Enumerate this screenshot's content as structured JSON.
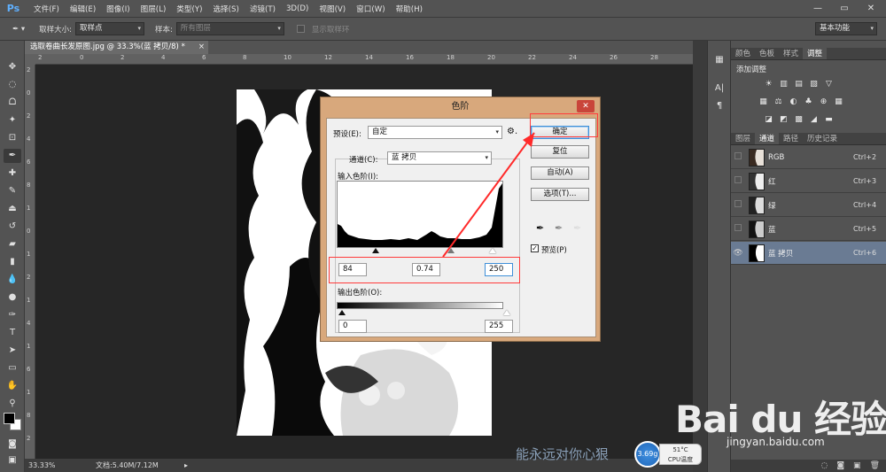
{
  "app": {
    "logo": "Ps"
  },
  "menu": [
    "文件(F)",
    "编辑(E)",
    "图像(I)",
    "图层(L)",
    "类型(Y)",
    "选择(S)",
    "滤镜(T)",
    "3D(D)",
    "视图(V)",
    "窗口(W)",
    "帮助(H)"
  ],
  "window_controls": {
    "minimize": "—",
    "restore": "▭",
    "close": "✕"
  },
  "options": {
    "sample_size_label": "取样大小:",
    "sample_size_value": "取样点",
    "sample_label": "样本:",
    "sample_value": "所有图层",
    "show_ring_label": "显示取样环",
    "workspace": "基本功能"
  },
  "document": {
    "tab_title": "选取卷曲长发原图.jpg @ 33.3%(蓝 拷贝/8) *",
    "close": "×"
  },
  "ruler_h": [
    "2",
    "0",
    "2",
    "4",
    "6",
    "8",
    "10",
    "12",
    "14",
    "16",
    "18",
    "20",
    "22",
    "24",
    "26",
    "28"
  ],
  "ruler_v": [
    "2",
    "0",
    "2",
    "4",
    "6",
    "8",
    "1",
    "0",
    "1",
    "2",
    "1",
    "4",
    "1",
    "6",
    "1",
    "8",
    "2"
  ],
  "status": {
    "zoom": "33.33%",
    "doc": "文档:5.40M/7.12M"
  },
  "panels": {
    "top_tabs": [
      "颜色",
      "色板",
      "样式",
      "调整"
    ],
    "adjust_title": "添加调整",
    "adjust_icons": [
      [
        "☀",
        "▥",
        "▤",
        "▧",
        "▽"
      ],
      [
        "▦",
        "⚖",
        "◐",
        "♣",
        "⊕",
        "▦"
      ],
      [
        "◪",
        "◩",
        "▩",
        "◢",
        "▬"
      ]
    ],
    "channel_tabs": [
      "图层",
      "通道",
      "路径",
      "历史记录"
    ],
    "channels": [
      {
        "name": "RGB",
        "key": "Ctrl+2"
      },
      {
        "name": "红",
        "key": "Ctrl+3"
      },
      {
        "name": "绿",
        "key": "Ctrl+4"
      },
      {
        "name": "蓝",
        "key": "Ctrl+5"
      },
      {
        "name": "蓝 拷贝",
        "key": "Ctrl+6"
      }
    ],
    "bottom_icons": [
      "◌",
      "◙",
      "▣",
      "🗑"
    ]
  },
  "levels_dialog": {
    "title": "色阶",
    "close": "✕",
    "preset_label": "预设(E):",
    "preset_value": "自定",
    "channel_label": "通道(C):",
    "channel_value": "蓝 拷贝",
    "input_label": "输入色阶(I):",
    "input_black": "84",
    "input_gamma": "0.74",
    "input_white": "250",
    "output_label": "输出色阶(O):",
    "output_black": "0",
    "output_white": "255",
    "buttons": {
      "ok": "确定",
      "reset": "复位",
      "auto": "自动(A)",
      "options": "选项(T)..."
    },
    "preview_label": "预览(P)",
    "preview_checked": "✓"
  },
  "overlay": {
    "caption": "能永远对你心狠",
    "speed": "3.69g",
    "cpu_temp": "51°C",
    "cpu_label": "CPU温度",
    "baidu_logo": "Bai du 经验",
    "baidu_url": "jingyan.baidu.com"
  }
}
